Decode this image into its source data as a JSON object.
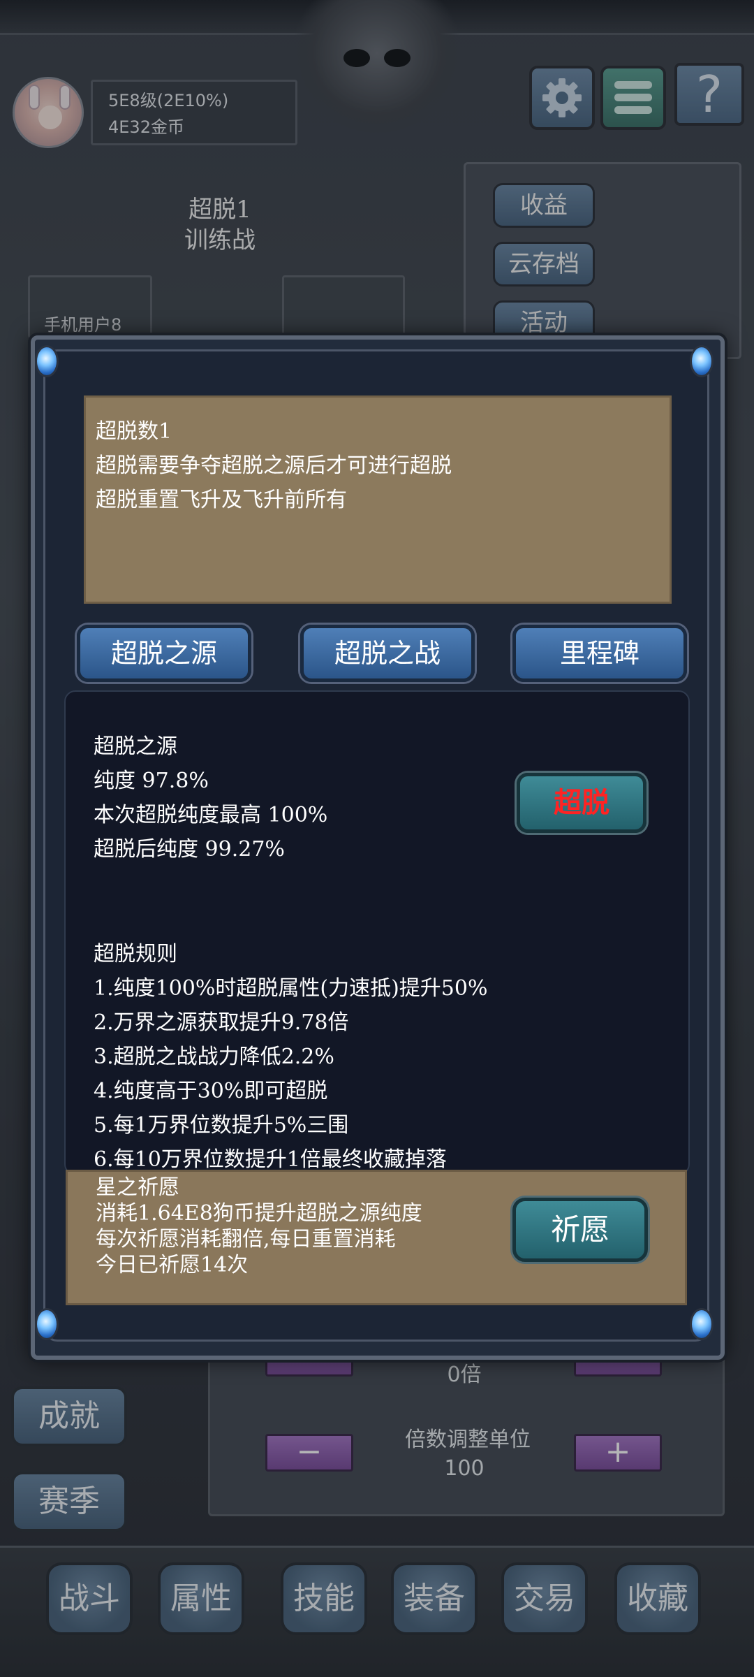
{
  "player": {
    "level_text": "5E8级(2E10%)",
    "gold_text": "4E32金币"
  },
  "stage": {
    "line1": "超脱1",
    "line2": "训练战"
  },
  "side_buttons": {
    "income": "收益",
    "cloud_save": "云存档",
    "events": "活动"
  },
  "user_tab": "手机用户8",
  "left_buttons": {
    "achievements": "成就",
    "season": "赛季"
  },
  "multiplier": {
    "value": "0倍",
    "step_label": "倍数调整单位",
    "step_value": "100",
    "minus": "−",
    "plus": "+"
  },
  "bottom_nav": [
    "战斗",
    "属性",
    "技能",
    "装备",
    "交易",
    "收藏"
  ],
  "help_glyph": "?",
  "dialog": {
    "info": [
      "超脱数1",
      "超脱需要争夺超脱之源后才可进行超脱",
      "超脱重置飞升及飞升前所有"
    ],
    "tabs": [
      "超脱之源",
      "超脱之战",
      "里程碑"
    ],
    "source": {
      "title": "超脱之源",
      "purity": "纯度  97.8%",
      "max_purity": "本次超脱纯度最高  100%",
      "after_purity": "超脱后纯度  99.27%"
    },
    "transcend_button": "超脱",
    "rules_title": "超脱规则",
    "rules": [
      "1.纯度100%时超脱属性(力速抵)提升50%",
      "2.万界之源获取提升9.78倍",
      "3.超脱之战战力降低2.2%",
      "4.纯度高于30%即可超脱",
      "5.每1万界位数提升5%三围",
      "6.每10万界位数提升1倍最终收藏掉落"
    ],
    "wish": {
      "title": "星之祈愿",
      "lines": [
        "消耗1.64E8狗币提升超脱之源纯度",
        "每次祈愿消耗翻倍,每日重置消耗",
        "今日已祈愿14次"
      ],
      "button": "祈愿"
    }
  },
  "colors": {
    "transcend_text": "#ff2323",
    "parchment": "#8c7a5d",
    "dialog_bg": "#222c3c",
    "panel_bg": "#121726"
  }
}
